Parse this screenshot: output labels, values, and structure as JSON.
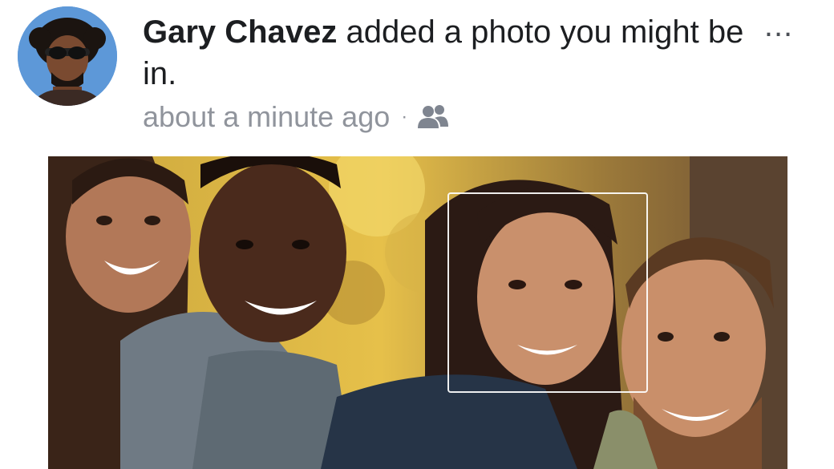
{
  "post": {
    "author": "Gary Chavez",
    "action": " added a photo you might be in.",
    "timestamp": "about a minute ago",
    "separator": "·",
    "audience_icon": "friends-icon",
    "more_label": "...",
    "avatar_icon": "profile-avatar"
  },
  "colors": {
    "primary_text": "#1c1e21",
    "secondary_text": "#90949c",
    "tag_box": "#ffffff"
  }
}
